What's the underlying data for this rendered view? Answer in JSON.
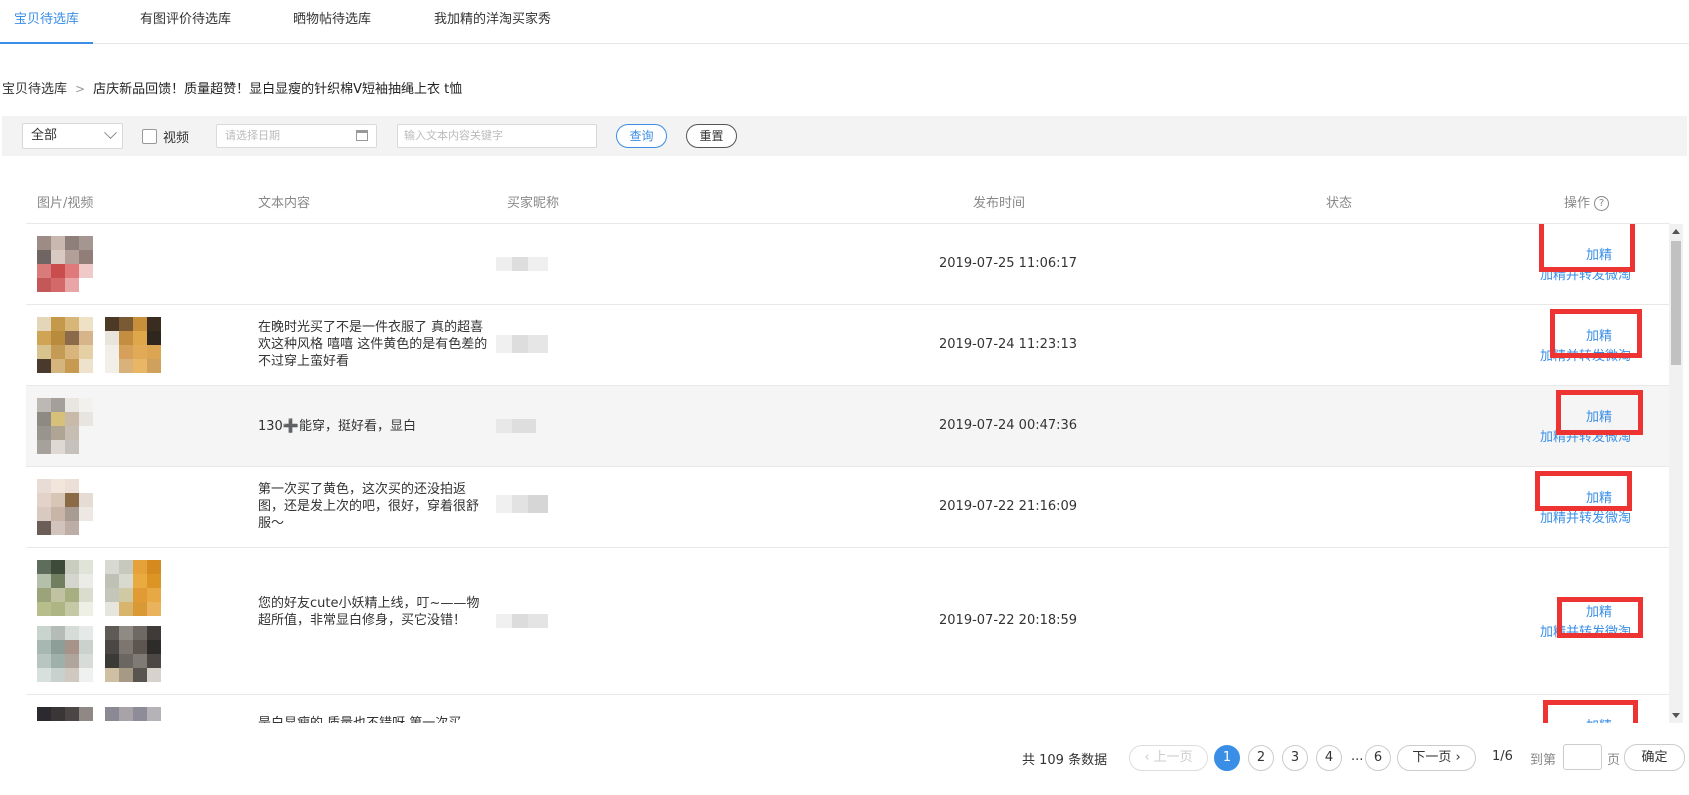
{
  "tabs": [
    {
      "label": "宝贝待选库",
      "active": true
    },
    {
      "label": "有图评价待选库",
      "active": false
    },
    {
      "label": "晒物帖待选库",
      "active": false
    },
    {
      "label": "我加精的洋淘买家秀",
      "active": false
    }
  ],
  "breadcrumb": {
    "root": "宝贝待选库",
    "current": "店庆新品回馈！质量超赞！显白显瘦的针织棉V短袖抽绳上衣 t恤"
  },
  "filters": {
    "select_value": "全部",
    "video_label": "视频",
    "date_placeholder": "请选择日期",
    "keyword_placeholder": "输入文本内容关键字",
    "query_label": "查询",
    "reset_label": "重置"
  },
  "table": {
    "headers": {
      "media": "图片/视频",
      "text": "文本内容",
      "nick": "买家昵称",
      "time": "发布时间",
      "status": "状态",
      "ops": "操作"
    },
    "rows": [
      {
        "text": "",
        "time": "2019-07-25 11:06:17",
        "op": "加精",
        "op2": "加精并转发微淘",
        "highlight": false
      },
      {
        "text": "在晚时光买了不是一件衣服了 真的超喜欢这种风格 嘻嘻 这件黄色的是有色差的 不过穿上蛮好看",
        "time": "2019-07-24 11:23:13",
        "op": "加精",
        "op2": "加精并转发微淘",
        "highlight": false
      },
      {
        "text": "130➕能穿，挺好看，显白",
        "time": "2019-07-24 00:47:36",
        "op": "加精",
        "op2": "加精并转发微淘",
        "highlight": true
      },
      {
        "text": "第一次买了黄色，这次买的还没拍返图，还是发上次的吧，很好，穿着很舒服～",
        "time": "2019-07-22 21:16:09",
        "op": "加精",
        "op2": "加精并转发微淘",
        "highlight": false
      },
      {
        "text": "您的好友cute小妖精上线，叮~——物超所值，非常显白修身，买它没错！",
        "time": "2019-07-22 20:18:59",
        "op": "加精",
        "op2": "加精并转发微淘",
        "highlight": false
      },
      {
        "text": "是白显瘦的 质量也不错呀 第一次买",
        "time": "",
        "op": "加精",
        "op2": "",
        "highlight": false
      }
    ]
  },
  "pagination": {
    "total": "共 109 条数据",
    "prev": "上一页",
    "pages": [
      "1",
      "2",
      "3",
      "4"
    ],
    "dots": "...",
    "last": "6",
    "next": "下一页",
    "info": "1/6",
    "goto_prefix": "到第",
    "goto_suffix": "页",
    "confirm": "确定"
  },
  "colors": {
    "accent": "#3a8ee6",
    "highlight_box": "#ee3333"
  }
}
